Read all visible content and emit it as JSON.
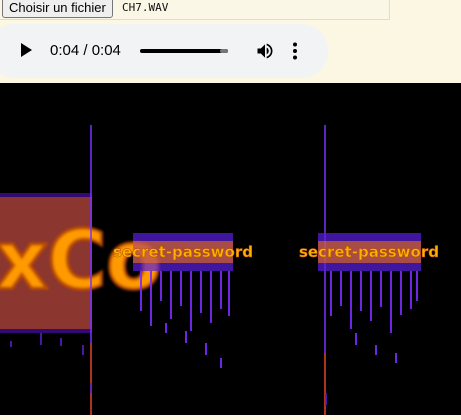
{
  "file_input": {
    "button_label": "Choisir un fichier",
    "file_name": "CH7.WAV"
  },
  "audio_player": {
    "time_display": "0:04 / 0:04",
    "progress": 0.9,
    "icons": {
      "play": "play-icon",
      "volume": "volume-icon",
      "menu": "more-vert-icon"
    }
  },
  "spectrogram": {
    "text_left": "xCo",
    "text_middle": "secret-password",
    "text_right": "secret-password",
    "colors": {
      "background": "#000000",
      "orange": "#ff9000",
      "purple": "#6a1bff",
      "red_line": "#d13a00"
    }
  }
}
